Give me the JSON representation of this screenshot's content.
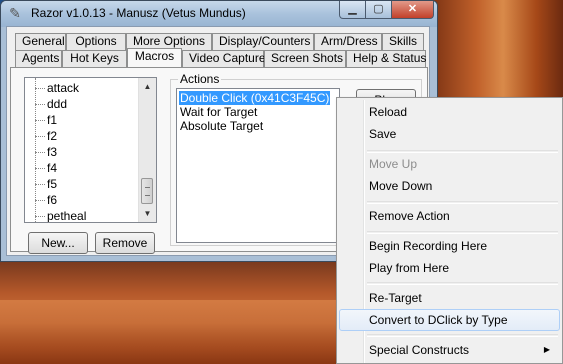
{
  "window": {
    "title": "Razor v1.0.13 - Manusz (Vetus Mundus)",
    "controls": {
      "minimize": "▁",
      "maximize": "▢",
      "close": "✕"
    }
  },
  "tabs_row1": [
    "General",
    "Options",
    "More Options",
    "Display/Counters",
    "Arm/Dress",
    "Skills"
  ],
  "tabs_row2": [
    "Agents",
    "Hot Keys",
    "Macros",
    "Video Capture",
    "Screen Shots",
    "Help & Status"
  ],
  "active_tab": "Macros",
  "macro_tree": [
    "attack",
    "ddd",
    "f1",
    "f2",
    "f3",
    "f4",
    "f5",
    "f6",
    "petheal"
  ],
  "buttons": {
    "new": "New...",
    "remove": "Remove",
    "play": "Play"
  },
  "actions": {
    "label": "Actions",
    "items": [
      "Double Click (0x41C3F45C)",
      "Wait for Target",
      "Absolute Target"
    ],
    "selected_index": 0
  },
  "context_menu": {
    "items": [
      {
        "label": "Reload",
        "enabled": true
      },
      {
        "label": "Save",
        "enabled": true
      },
      {
        "label": "Move Up",
        "enabled": false
      },
      {
        "label": "Move Down",
        "enabled": true
      },
      {
        "label": "Remove Action",
        "enabled": true
      },
      {
        "label": "Begin Recording Here",
        "enabled": true
      },
      {
        "label": "Play from Here",
        "enabled": true
      },
      {
        "label": "Re-Target",
        "enabled": true
      },
      {
        "label": "Convert to DClick by Type",
        "enabled": true,
        "highlighted": true
      },
      {
        "label": "Special Constructs",
        "enabled": true,
        "has_submenu": true
      }
    ]
  },
  "colors": {
    "selection": "#3399ff",
    "menu_hover_border": "#aecff7"
  }
}
